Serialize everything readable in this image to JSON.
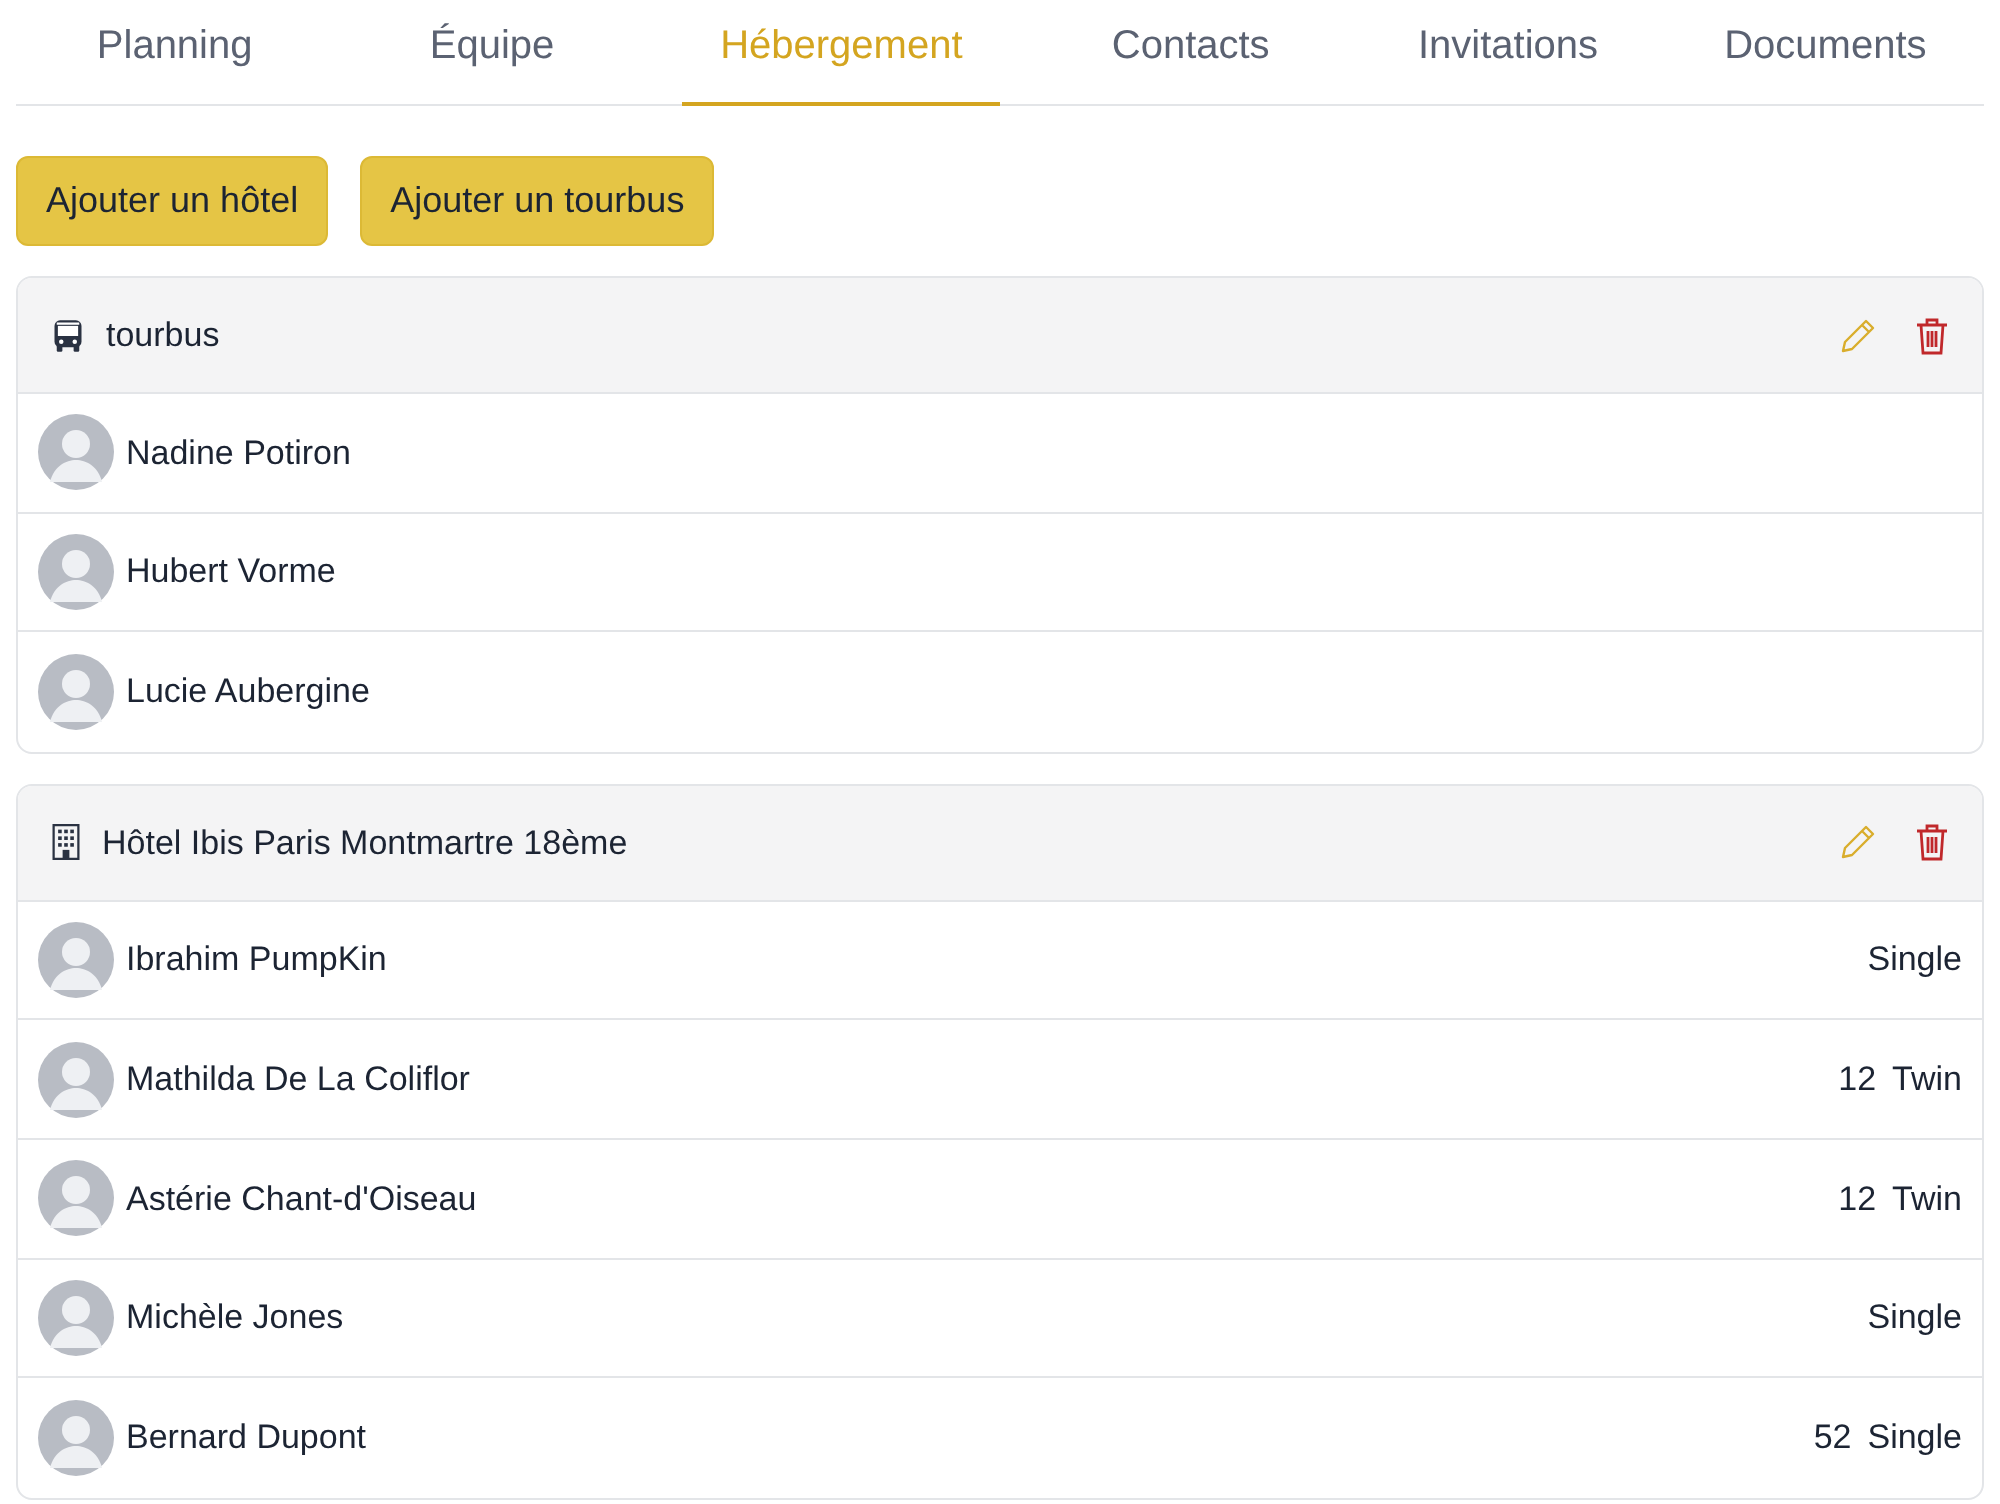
{
  "tabs": [
    {
      "label": "Planning",
      "selected": false
    },
    {
      "label": "Équipe",
      "selected": false
    },
    {
      "label": "Hébergement",
      "selected": true
    },
    {
      "label": "Contacts",
      "selected": false
    },
    {
      "label": "Invitations",
      "selected": false
    },
    {
      "label": "Documents",
      "selected": false
    }
  ],
  "buttons": [
    "Ajouter un hôtel",
    "Ajouter un tourbus"
  ],
  "groups": [
    {
      "kind": "bus",
      "title": "tourbus",
      "people": [
        {
          "name": "Nadine Potiron"
        },
        {
          "name": "Hubert Vorme"
        },
        {
          "name": "Lucie Aubergine"
        }
      ]
    },
    {
      "kind": "hotel",
      "title": "Hôtel Ibis Paris Montmartre 18ème",
      "people": [
        {
          "name": "Ibrahim PumpKin",
          "room_type": "Single"
        },
        {
          "name": "Mathilda De La Coliflor",
          "room": "12",
          "room_type": "Twin"
        },
        {
          "name": "Astérie Chant-d'Oiseau",
          "room": "12",
          "room_type": "Twin"
        },
        {
          "name": "Michèle Jones",
          "room_type": "Single"
        },
        {
          "name": "Bernard Dupont",
          "room": "52",
          "room_type": "Single"
        }
      ]
    }
  ]
}
